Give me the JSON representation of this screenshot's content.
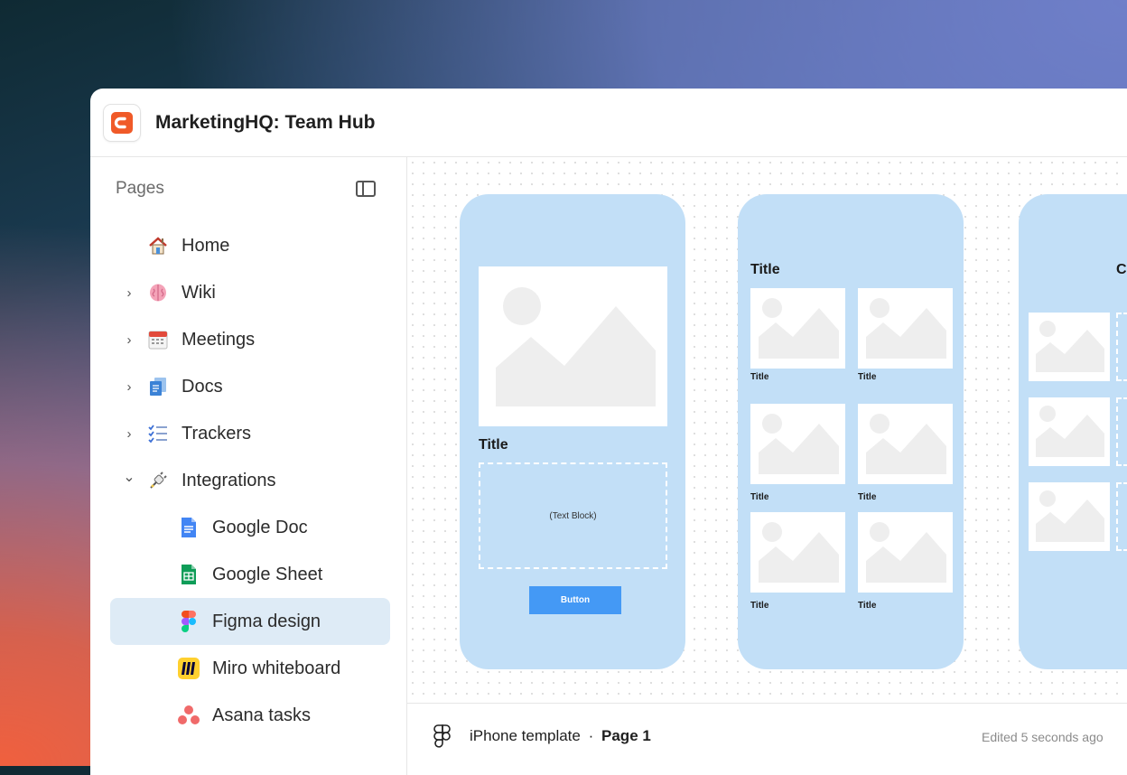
{
  "app": {
    "title": "MarketingHQ: Team Hub",
    "brand_color": "#f05a28"
  },
  "sidebar": {
    "title": "Pages",
    "items": [
      {
        "label": "Home",
        "icon": "house-icon",
        "chevron": ""
      },
      {
        "label": "Wiki",
        "icon": "brain-icon",
        "chevron": "›"
      },
      {
        "label": "Meetings",
        "icon": "calendar-icon",
        "chevron": "›"
      },
      {
        "label": "Docs",
        "icon": "documents-icon",
        "chevron": "›"
      },
      {
        "label": "Trackers",
        "icon": "checklist-icon",
        "chevron": "›"
      },
      {
        "label": "Integrations",
        "icon": "plug-icon",
        "chevron": "⌄"
      },
      {
        "label": "Google Doc",
        "icon": "google-doc-icon"
      },
      {
        "label": "Google Sheet",
        "icon": "google-sheet-icon"
      },
      {
        "label": "Figma design",
        "icon": "figma-icon",
        "active": true
      },
      {
        "label": "Miro whiteboard",
        "icon": "miro-icon"
      },
      {
        "label": "Asana tasks",
        "icon": "asana-icon"
      }
    ]
  },
  "canvas": {
    "phone1": {
      "title": "Title",
      "text_block": "(Text Block)",
      "button": "Button"
    },
    "phone2": {
      "title": "Title",
      "captions": [
        "Title",
        "Title",
        "Title",
        "Title",
        "Title",
        "Title"
      ]
    },
    "phone3": {
      "title_fragment": "C"
    }
  },
  "footer": {
    "file_name": "iPhone template",
    "separator": "·",
    "page": "Page 1",
    "edited": "Edited 5 seconds ago"
  },
  "colors": {
    "phone_bg": "#c2dff7",
    "button_blue": "#4499f5",
    "active_item_bg": "#deebf6"
  }
}
